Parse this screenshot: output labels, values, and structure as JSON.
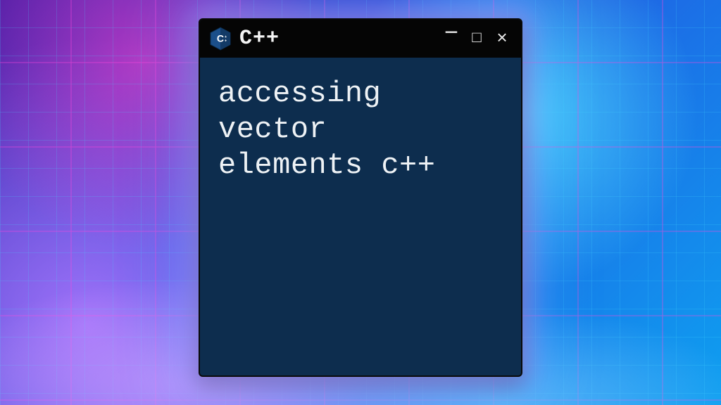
{
  "window": {
    "title": "C++",
    "icon_name": "cpp-icon",
    "controls": {
      "minimize": "−",
      "maximize": "□",
      "close": "×"
    }
  },
  "content": {
    "text": "accessing\nvector\nelements c++"
  },
  "colors": {
    "window_bg": "#0d2d4e",
    "titlebar_bg": "#050505",
    "text": "#eef2f5"
  }
}
